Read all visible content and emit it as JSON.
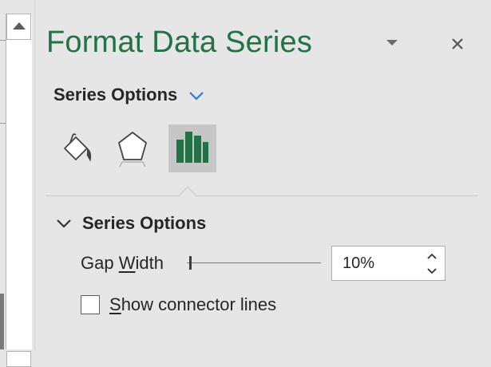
{
  "pane": {
    "title": "Format Data Series",
    "menu_icon": "caret-down-icon",
    "close_icon": "close-icon"
  },
  "options_dropdown": {
    "label": "Series Options",
    "icon": "chevron-down-icon",
    "accent_color": "#2b7cd3"
  },
  "category_tabs": [
    {
      "name": "Fill & Line",
      "icon": "paint-bucket-icon",
      "selected": false
    },
    {
      "name": "Effects",
      "icon": "pentagon-icon",
      "selected": false
    },
    {
      "name": "Series Options",
      "icon": "bar-chart-icon",
      "selected": true
    }
  ],
  "section": {
    "title": "Series Options",
    "expanded": true,
    "gap_width": {
      "label_pre": "Gap ",
      "label_accel": "W",
      "label_post": "idth",
      "value": "10%",
      "slider_fraction": 0.02
    },
    "show_connector_lines": {
      "label_accel": "S",
      "label_rest": "how connector lines",
      "checked": false
    }
  },
  "colors": {
    "title": "#217346",
    "chart_icon": "#217346",
    "pane_background": "#e6e6e6",
    "selected_tab": "#c6c6c6"
  }
}
